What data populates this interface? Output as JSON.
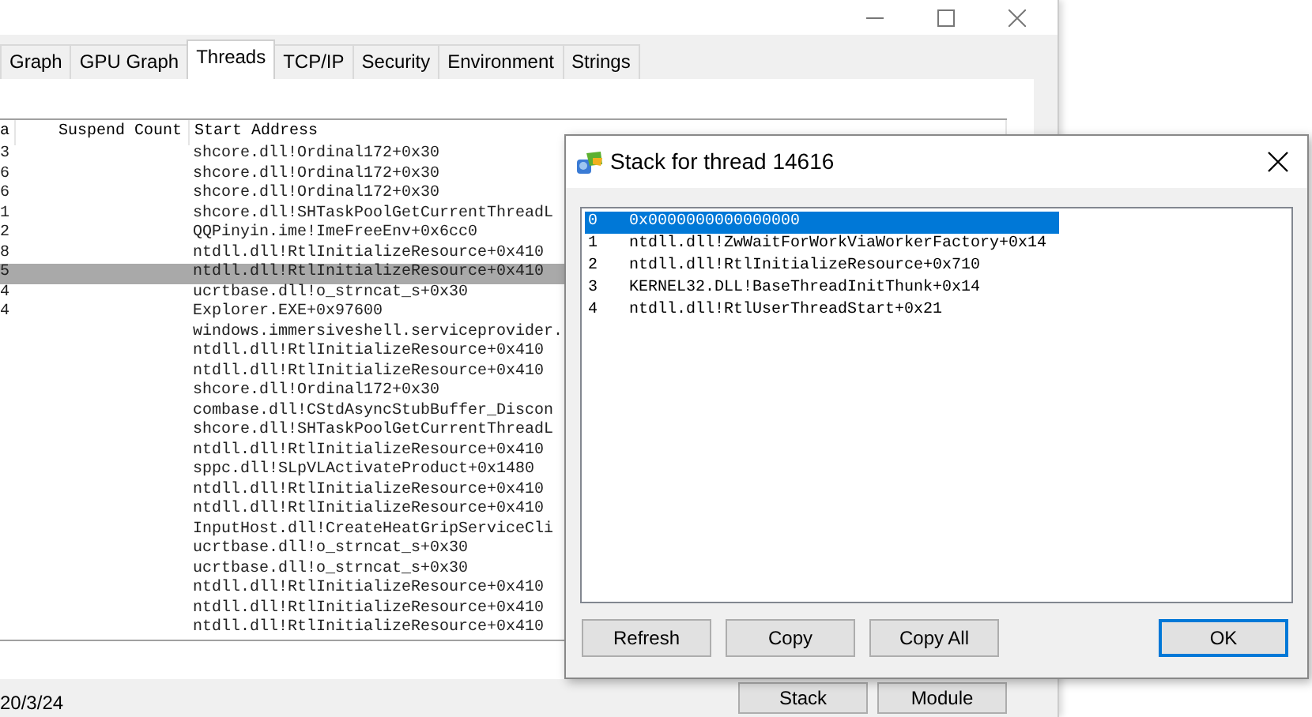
{
  "tabs": [
    {
      "label": "Graph",
      "selected": false
    },
    {
      "label": "GPU Graph",
      "selected": false
    },
    {
      "label": "Threads",
      "selected": true
    },
    {
      "label": "TCP/IP",
      "selected": false
    },
    {
      "label": "Security",
      "selected": false
    },
    {
      "label": "Environment",
      "selected": false
    },
    {
      "label": "Strings",
      "selected": false
    }
  ],
  "thread_list": {
    "columns": [
      "a",
      "Suspend Count",
      "Start Address"
    ],
    "rows": [
      {
        "column_1": "3",
        "start_address": "shcore.dll!Ordinal172+0x30",
        "selected": false
      },
      {
        "column_1": "6",
        "start_address": "shcore.dll!Ordinal172+0x30",
        "selected": false
      },
      {
        "column_1": "6",
        "start_address": "shcore.dll!Ordinal172+0x30",
        "selected": false
      },
      {
        "column_1": "1",
        "start_address": "shcore.dll!SHTaskPoolGetCurrentThreadL",
        "selected": false
      },
      {
        "column_1": "2",
        "start_address": "QQPinyin.ime!ImeFreeEnv+0x6cc0",
        "selected": false
      },
      {
        "column_1": "8",
        "start_address": "ntdll.dll!RtlInitializeResource+0x410",
        "selected": false
      },
      {
        "column_1": "5",
        "start_address": "ntdll.dll!RtlInitializeResource+0x410",
        "selected": true
      },
      {
        "column_1": "4",
        "start_address": "ucrtbase.dll!o_strncat_s+0x30",
        "selected": false
      },
      {
        "column_1": "4",
        "start_address": "Explorer.EXE+0x97600",
        "selected": false
      },
      {
        "start_address": "windows.immersiveshell.serviceprovider.",
        "selected": false
      },
      {
        "start_address": "ntdll.dll!RtlInitializeResource+0x410",
        "selected": false
      },
      {
        "start_address": "ntdll.dll!RtlInitializeResource+0x410",
        "selected": false
      },
      {
        "start_address": "shcore.dll!Ordinal172+0x30",
        "selected": false
      },
      {
        "start_address": "combase.dll!CStdAsyncStubBuffer_Discon",
        "selected": false
      },
      {
        "start_address": "shcore.dll!SHTaskPoolGetCurrentThreadL",
        "selected": false
      },
      {
        "start_address": "ntdll.dll!RtlInitializeResource+0x410",
        "selected": false
      },
      {
        "start_address": "sppc.dll!SLpVLActivateProduct+0x1480",
        "selected": false
      },
      {
        "start_address": "ntdll.dll!RtlInitializeResource+0x410",
        "selected": false
      },
      {
        "start_address": "ntdll.dll!RtlInitializeResource+0x410",
        "selected": false
      },
      {
        "start_address": "InputHost.dll!CreateHeatGripServiceCli",
        "selected": false
      },
      {
        "start_address": "ucrtbase.dll!o_strncat_s+0x30",
        "selected": false
      },
      {
        "start_address": "ucrtbase.dll!o_strncat_s+0x30",
        "selected": false
      },
      {
        "start_address": "ntdll.dll!RtlInitializeResource+0x410",
        "selected": false
      },
      {
        "start_address": "ntdll.dll!RtlInitializeResource+0x410",
        "selected": false
      },
      {
        "start_address": "ntdll.dll!RtlInitializeResource+0x410",
        "selected": false
      }
    ]
  },
  "date": "20/3/24",
  "window_buttons": [
    "Stack",
    "Module"
  ],
  "dialog": {
    "title": "Stack for thread 14616",
    "frames": [
      {
        "index": "0",
        "address": "0x0000000000000000",
        "selected": true
      },
      {
        "index": "1",
        "address": "ntdll.dll!ZwWaitForWorkViaWorkerFactory+0x14",
        "selected": false
      },
      {
        "index": "2",
        "address": "ntdll.dll!RtlInitializeResource+0x710",
        "selected": false
      },
      {
        "index": "3",
        "address": "KERNEL32.DLL!BaseThreadInitThunk+0x14",
        "selected": false
      },
      {
        "index": "4",
        "address": "ntdll.dll!RtlUserThreadStart+0x21",
        "selected": false
      }
    ],
    "buttons": [
      {
        "label": "Refresh",
        "default": false
      },
      {
        "label": "Copy",
        "default": false
      },
      {
        "label": "Copy All",
        "default": false
      },
      {
        "label": "OK",
        "default": true
      }
    ]
  }
}
